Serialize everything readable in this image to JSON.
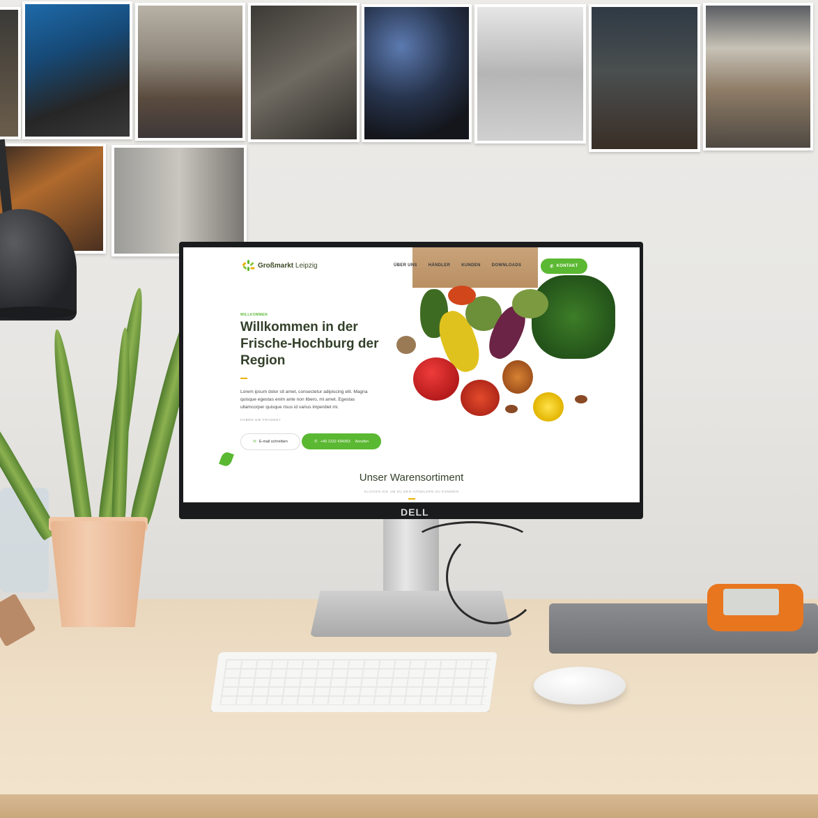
{
  "website": {
    "logo": {
      "name": "Großmarkt",
      "city": "Leipzig"
    },
    "nav": [
      {
        "label": "ÜBER UNS"
      },
      {
        "label": "HÄNDLER"
      },
      {
        "label": "KUNDEN"
      },
      {
        "label": "DOWNLOADS"
      }
    ],
    "cta_label": "KONTAKT",
    "hero": {
      "eyebrow": "WILLKOMMEN",
      "title": "Willkommen in der Frische-Hochburg der Region",
      "text": "Lorem ipsum dolor sit amet, consectetur adipiscing elit. Magna quisque egestas enim ante non libero, mi amet. Egestas ullamcorper quisque risus id varius imperdiet mi.",
      "question": "HABEN SIE FRAGEN?",
      "mail_button": "E-mail schreiben",
      "call_number": "+49 1232 434353",
      "call_label": "Anrufen"
    },
    "section": {
      "title": "Unser Warensortiment",
      "subtitle": "KLICKEN SIE UM ZU DEN HÄNDLERN ZU KOMMEN"
    },
    "colors": {
      "accent": "#5bb832",
      "heading": "#33402a",
      "rule": "#e8b100"
    }
  },
  "monitor_brand": "DELL",
  "icons": [
    "phone-icon",
    "mail-icon",
    "leaf-icon",
    "logo-icon"
  ]
}
